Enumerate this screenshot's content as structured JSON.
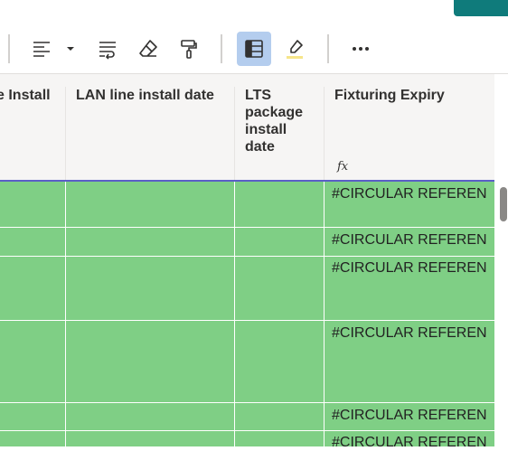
{
  "toolbar": {
    "buttons": [
      {
        "name": "align-left",
        "icon": "align-left-icon",
        "active": false
      },
      {
        "name": "align-dropdown",
        "icon": "caret-down-icon",
        "active": false
      },
      {
        "name": "wrap-text",
        "icon": "wrap-text-icon",
        "active": false
      },
      {
        "name": "clear",
        "icon": "eraser-icon",
        "active": false
      },
      {
        "name": "format-painter",
        "icon": "paint-roller-icon",
        "active": false
      },
      {
        "name": "table-format",
        "icon": "table-icon",
        "active": true
      },
      {
        "name": "highlight",
        "icon": "highlighter-icon",
        "active": false
      },
      {
        "name": "more",
        "icon": "more-horizontal-icon",
        "active": false
      }
    ],
    "active_color": "#b4cdee"
  },
  "columns": [
    {
      "label": "e Install"
    },
    {
      "label": "LAN line install date"
    },
    {
      "label": "LTS\npackage\ninstall\ndate"
    },
    {
      "label": "Fixturing Expiry",
      "formula_icon": "function-icon",
      "formula_glyph": "fx"
    }
  ],
  "rows": [
    {
      "fixturing_expiry": "#CIRCULAR REFERENCE!"
    },
    {
      "fixturing_expiry": "#CIRCULAR REFERENCE!"
    },
    {
      "fixturing_expiry": "#CIRCULAR REFERENCE!"
    },
    {
      "fixturing_expiry": "#CIRCULAR REFERENCE!"
    },
    {
      "fixturing_expiry": "#CIRCULAR REFERENCE!"
    },
    {
      "fixturing_expiry": "#CIRCULAR REFERENCE!"
    }
  ],
  "colors": {
    "row_fill": "#7fcf85",
    "header_fill": "#f6f5f4",
    "header_underline": "#5b5fc7",
    "share_button": "#0f7b7b"
  }
}
